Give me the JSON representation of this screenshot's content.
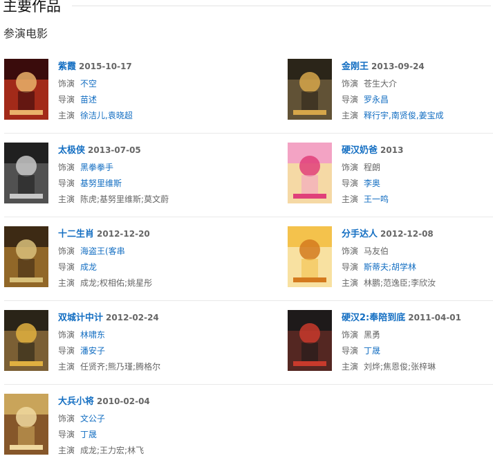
{
  "section": {
    "title": "主要作品",
    "subtitle": "参演电影"
  },
  "labels": {
    "role": "饰演",
    "director": "导演",
    "cast": "主演"
  },
  "films": [
    {
      "title": "紫霞",
      "date": "2015-10-17",
      "role": "不空",
      "director": "苗述",
      "cast": "徐洁儿,袁晓超",
      "poster_colors": [
        "#3a0c0c",
        "#b5301c",
        "#e9b26a"
      ]
    },
    {
      "title": "金刚王",
      "date": "2013-09-24",
      "role": "苍生大介",
      "director": "罗永昌",
      "cast": "释行宇,南贤俊,姜宝成",
      "poster_colors": [
        "#2b2519",
        "#6b5a3c",
        "#d6a64a"
      ]
    },
    {
      "title": "太极侠",
      "date": "2013-07-05",
      "role": "黑拳拳手",
      "director": "基努里维斯",
      "cast": "陈虎;基努里维斯;莫文蔚",
      "poster_colors": [
        "#202020",
        "#5a5a5a",
        "#c8c8c8"
      ]
    },
    {
      "title": "硬汉奶爸",
      "date": "2013",
      "role": "程朗",
      "director": "李奥",
      "cast": "王一鸣",
      "poster_colors": [
        "#f3a3c4",
        "#f5e3a0",
        "#e0407a"
      ]
    },
    {
      "title": "十二生肖",
      "date": "2012-12-20",
      "role": "海盗王(客串",
      "director": "成龙",
      "cast": "成龙;权相佑;姚星彤",
      "poster_colors": [
        "#3d2a14",
        "#a0722c",
        "#d8c07a"
      ]
    },
    {
      "title": "分手达人",
      "date": "2012-12-08",
      "role": "马友伯",
      "director": "斯蒂夫;胡学林",
      "cast": "林鹏;范逸臣;李欣汝",
      "poster_colors": [
        "#f4c24c",
        "#f8e6b0",
        "#d47a1e"
      ]
    },
    {
      "title": "双城计中计",
      "date": "2012-02-24",
      "role": "林啸东",
      "director": "潘安子",
      "cast": "任贤齐;熊乃瑾;腾格尔",
      "poster_colors": [
        "#2a2418",
        "#8a6a3a",
        "#e0b040"
      ]
    },
    {
      "title": "硬汉2:奉陪到底",
      "date": "2011-04-01",
      "role": "黑勇",
      "director": "丁晟",
      "cast": "刘烨;焦恩俊;张梓琳",
      "poster_colors": [
        "#1e1a1a",
        "#5e2a24",
        "#c83a2c"
      ]
    },
    {
      "title": "大兵小将",
      "date": "2010-02-04",
      "role": "文公子",
      "director": "丁晟",
      "cast": "成龙;王力宏;林飞",
      "poster_colors": [
        "#c9a45a",
        "#7a4a22",
        "#f0d9a0"
      ]
    }
  ]
}
